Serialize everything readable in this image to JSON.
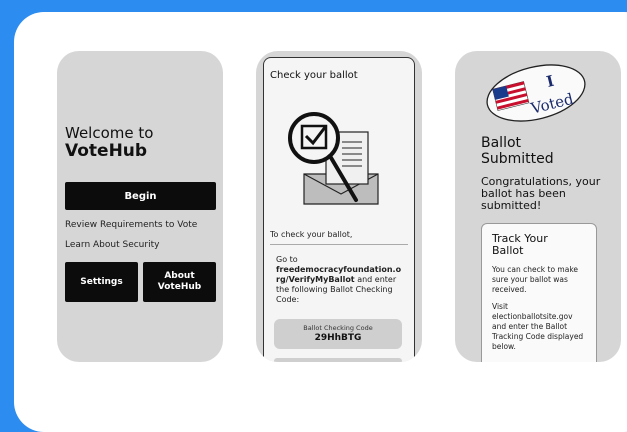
{
  "screen1": {
    "welcome_line1": "Welcome to",
    "welcome_line2": "VoteHub",
    "begin_label": "Begin",
    "link_requirements": "Review Requirements to Vote",
    "link_security": "Learn About Security",
    "settings_label": "Settings",
    "about_line1": "About",
    "about_line2": "VoteHub"
  },
  "screen2": {
    "title": "Check your ballot",
    "to_check": "To check your ballot,",
    "goto_prefix": "Go to",
    "goto_url": "freedemocracyfoundation.org/VerifyMyBallot",
    "goto_suffix": "and enter the following Ballot Checking Code:",
    "code_label": "Ballot Checking Code",
    "code_value": "29HhBTG"
  },
  "screen3": {
    "sticker_line1": "I",
    "sticker_line2": "Voted",
    "title_line1": "Ballot",
    "title_line2": "Submitted",
    "congrats": "Congratulations, your ballot has been submitted!",
    "track_title_line1": "Track Your",
    "track_title_line2": "Ballot",
    "track_p1": "You can check to make sure your ballot was received.",
    "track_p2": "Visit electionballotsite.gov and enter the Ballot Tracking Code displayed below."
  },
  "colors": {
    "background": "#2d8cf0",
    "card": "#ffffff",
    "phone": "#d6d6d6",
    "button": "#0c0c0c"
  }
}
